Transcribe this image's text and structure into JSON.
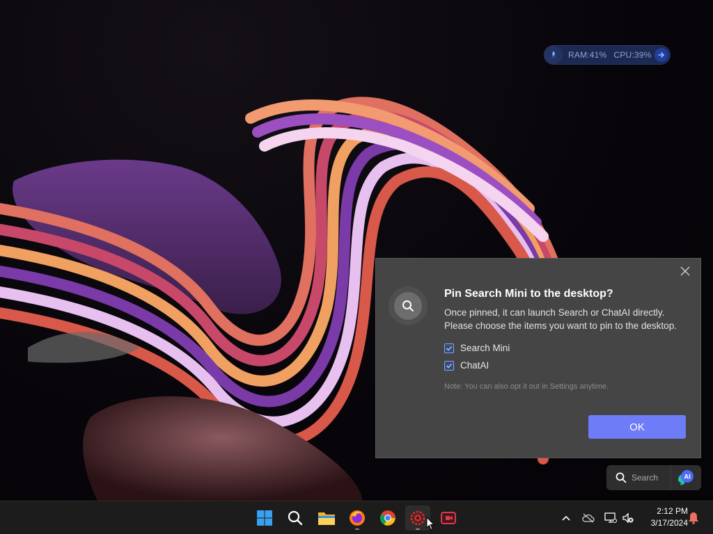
{
  "perf_widget": {
    "ram": "RAM:41%",
    "cpu": "CPU:39%",
    "icon": "rocket-icon"
  },
  "dialog": {
    "title": "Pin Search Mini to the desktop?",
    "description_line1": "Once pinned, it can launch Search or ChatAI directly.",
    "description_line2": "Please choose the items you want to pin to the desktop.",
    "options": [
      {
        "label": "Search Mini",
        "checked": true
      },
      {
        "label": "ChatAI",
        "checked": true
      }
    ],
    "note": "Note: You can also opt it out in Settings anytime.",
    "ok_label": "OK",
    "accent": "#6f7cf7"
  },
  "search_mini": {
    "label": "Search",
    "ai_badge": "AI"
  },
  "taskbar": {
    "apps": [
      "start-icon",
      "search-icon",
      "file-explorer-icon",
      "firefox-icon",
      "chrome-icon",
      "app-gear-icon",
      "screen-recorder-icon"
    ],
    "tray": [
      "chevron-up-icon",
      "cloud-offline-icon",
      "network-icon",
      "volume-muted-icon",
      "notification-bell-icon"
    ],
    "time": "2:12 PM",
    "date": "3/17/2024"
  }
}
